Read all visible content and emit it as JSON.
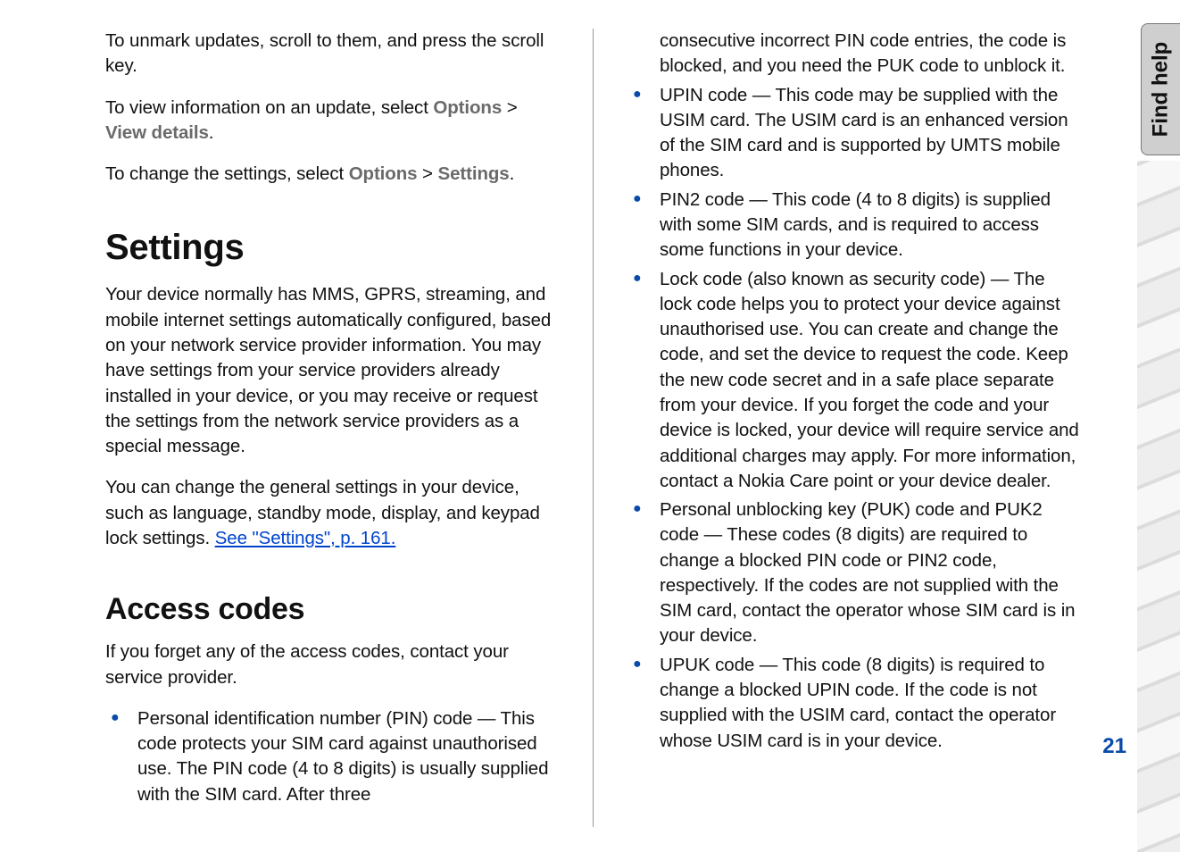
{
  "sideTab": "Find help",
  "pageNumber": "21",
  "col1": {
    "p1": "To unmark updates, scroll to them, and press the scroll key.",
    "p2_a": "To view information on an update, select ",
    "p2_opt": "Options",
    "p2_gt": " > ",
    "p2_view": "View details",
    "p2_end": ".",
    "p3_a": "To change the settings, select ",
    "p3_opt": "Options",
    "p3_gt": " > ",
    "p3_set": "Settings",
    "p3_end": ".",
    "h_settings": "Settings",
    "p4": "Your device normally has MMS, GPRS, streaming, and mobile internet settings automatically configured, based on your network service provider information. You may have settings from your service providers already installed in your device, or you may receive or request the settings from the network service providers as a special message.",
    "p5_a": "You can change the general settings in your device, such as language, standby mode, display, and keypad lock settings. ",
    "p5_link": "See \"Settings\", p. 161.",
    "h_access": "Access codes",
    "p6": "If you forget any of the access codes, contact your service provider.",
    "li1": "Personal identification number (PIN) code — This code protects your SIM card against unauthorised use. The PIN code (4 to 8 digits) is usually supplied with the SIM card. After three"
  },
  "col2": {
    "cont": "consecutive incorrect PIN code entries, the code is blocked, and you need the PUK code to unblock it.",
    "li2": "UPIN code — This code may be supplied with the USIM card. The USIM card is an enhanced version of the SIM card and is supported by UMTS mobile phones.",
    "li3": "PIN2 code  — This code (4 to 8 digits) is supplied with some SIM cards, and is required to access some functions in your device.",
    "li4": "Lock code (also known as security code) — The lock code helps you to protect your device against unauthorised use. You can create and change the code, and set the device to request the code. Keep the new code secret and in a safe place separate from your device. If you forget the code and your device is locked, your device will require service and additional charges may apply. For more information, contact a Nokia Care point or your device dealer.",
    "li5": "Personal unblocking key (PUK) code and PUK2 code — These codes (8 digits) are required to change a blocked PIN code or PIN2 code, respectively. If the codes are not supplied with the SIM card, contact the operator whose SIM card is in your device.",
    "li6": "UPUK code — This code (8 digits) is required to change a blocked UPIN code. If the code is not supplied with the USIM card, contact the operator whose USIM card is in your device."
  }
}
